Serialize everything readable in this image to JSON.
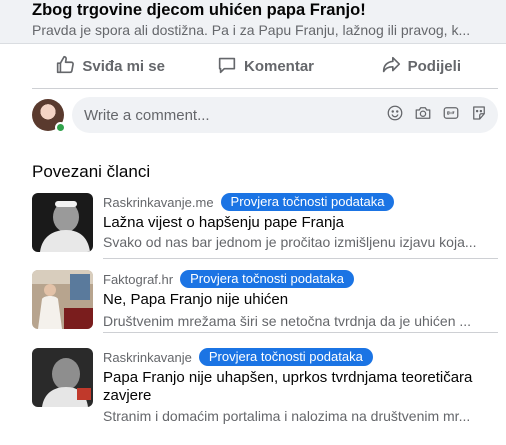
{
  "link_preview": {
    "title": "Zbog trgovine djecom uhićen papa Franjo!",
    "description": "Pravda je spora ali dostižna. Pa i za Papu Franju, lažnog ili pravog, k..."
  },
  "actions": {
    "like_label": "Sviđa mi se",
    "comment_label": "Komentar",
    "share_label": "Podijeli"
  },
  "comment": {
    "placeholder": "Write a comment...",
    "icons": [
      "emoji-icon",
      "camera-icon",
      "gif-icon",
      "sticker-icon"
    ]
  },
  "related": {
    "heading": "Povezani članci",
    "articles": [
      {
        "source": "Raskrinkavanje.me",
        "badge": "Provjera točnosti podataka",
        "title": "Lažna vijest o hapšenju pape Franja",
        "snippet": "Svako od nas bar jednom je pročitao izmišljenu izjavu koja..."
      },
      {
        "source": "Faktograf.hr",
        "badge": "Provjera točnosti podataka",
        "title": "Ne, Papa Franjo nije uhićen",
        "snippet": "Društvenim mrežama širi se netočna tvrdnja da je uhićen ..."
      },
      {
        "source": "Raskrinkavanje",
        "badge": "Provjera točnosti podataka",
        "title": "Papa Franjo nije uhapšen, uprkos tvrdnjama teoretičara zavjere",
        "snippet": "Stranim i domaćim portalima i nalozima na društvenim mr..."
      }
    ]
  },
  "colors": {
    "badge": "#1b74e4",
    "online": "#31a24c",
    "muted_text": "#65676b"
  }
}
